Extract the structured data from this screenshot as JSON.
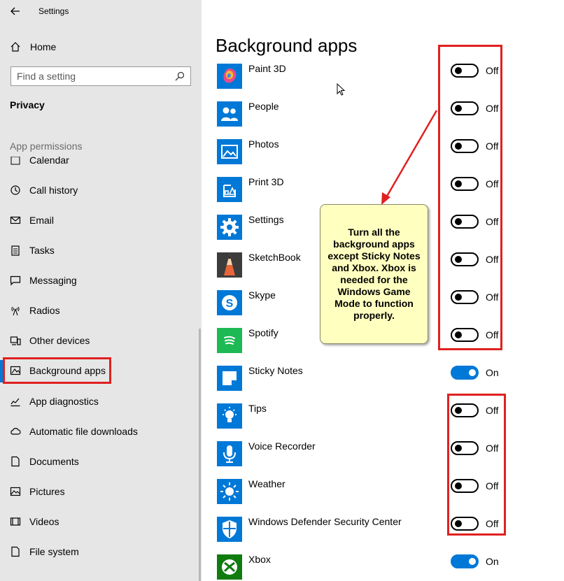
{
  "window": {
    "title": "Settings"
  },
  "sidebar": {
    "home_label": "Home",
    "search_placeholder": "Find a setting",
    "section_title": "Privacy",
    "group_header": "App permissions",
    "items": [
      {
        "label": "Calendar",
        "icon": "calendar-icon"
      },
      {
        "label": "Call history",
        "icon": "history-icon"
      },
      {
        "label": "Email",
        "icon": "mail-icon"
      },
      {
        "label": "Tasks",
        "icon": "tasks-icon"
      },
      {
        "label": "Messaging",
        "icon": "chat-icon"
      },
      {
        "label": "Radios",
        "icon": "radio-tower-icon"
      },
      {
        "label": "Other devices",
        "icon": "devices-icon"
      },
      {
        "label": "Background apps",
        "icon": "background-apps-icon",
        "active": true
      },
      {
        "label": "App diagnostics",
        "icon": "diagnostics-icon"
      },
      {
        "label": "Automatic file downloads",
        "icon": "cloud-icon"
      },
      {
        "label": "Documents",
        "icon": "document-icon"
      },
      {
        "label": "Pictures",
        "icon": "picture-icon"
      },
      {
        "label": "Videos",
        "icon": "video-icon"
      },
      {
        "label": "File system",
        "icon": "file-icon"
      }
    ]
  },
  "main": {
    "title": "Background apps",
    "apps": [
      {
        "name": "Paint 3D",
        "state": "Off",
        "on": false,
        "icon": "paint-3d-icon"
      },
      {
        "name": "People",
        "state": "Off",
        "on": false,
        "icon": "people-icon"
      },
      {
        "name": "Photos",
        "state": "Off",
        "on": false,
        "icon": "photos-icon"
      },
      {
        "name": "Print 3D",
        "state": "Off",
        "on": false,
        "icon": "print-3d-icon"
      },
      {
        "name": "Settings",
        "state": "Off",
        "on": false,
        "icon": "settings-gear-icon"
      },
      {
        "name": "SketchBook",
        "state": "Off",
        "on": false,
        "icon": "sketchbook-icon"
      },
      {
        "name": "Skype",
        "state": "Off",
        "on": false,
        "icon": "skype-icon"
      },
      {
        "name": "Spotify",
        "state": "Off",
        "on": false,
        "icon": "spotify-icon"
      },
      {
        "name": "Sticky Notes",
        "state": "On",
        "on": true,
        "icon": "sticky-notes-icon"
      },
      {
        "name": "Tips",
        "state": "Off",
        "on": false,
        "icon": "tips-lightbulb-icon"
      },
      {
        "name": "Voice Recorder",
        "state": "Off",
        "on": false,
        "icon": "microphone-icon"
      },
      {
        "name": "Weather",
        "state": "Off",
        "on": false,
        "icon": "weather-sun-icon"
      },
      {
        "name": "Windows Defender Security Center",
        "state": "Off",
        "on": false,
        "icon": "shield-icon"
      },
      {
        "name": "Xbox",
        "state": "On",
        "on": true,
        "icon": "xbox-icon"
      }
    ]
  },
  "annotation": {
    "callout_text": "Turn all the background apps except Sticky Notes and Xbox. Xbox is needed for the Windows Game Mode to function properly."
  },
  "colors": {
    "accent": "#0078d7",
    "sidebar_bg": "#e6e6e6",
    "annotation_red": "#e02020",
    "callout_bg": "#ffffc0",
    "tile_blue": "#0078d7",
    "spotify_green": "#1db954",
    "xbox_green": "#107c10"
  }
}
